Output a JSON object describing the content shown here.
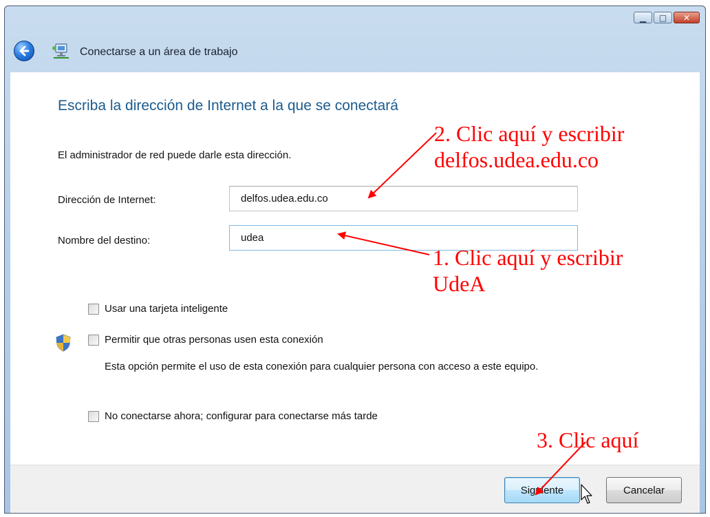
{
  "window": {
    "title": "Conectarse a un área de trabajo",
    "controls": {
      "minimize_icon": "minimize-icon",
      "maximize_icon": "maximize-icon",
      "close_icon": "close-icon"
    }
  },
  "icons": {
    "back": "back-arrow-icon",
    "wizard": "network-workplace-icon",
    "shield": "uac-shield-icon",
    "cursor": "mouse-pointer-icon"
  },
  "main": {
    "heading": "Escriba la dirección de Internet a la que se conectará",
    "help_text": "El administrador de red puede darle esta dirección.",
    "address_label": "Dirección de Internet:",
    "address_value": "delfos.udea.edu.co",
    "destination_label": "Nombre del destino:",
    "destination_value": "udea",
    "smartcard_label": "Usar una tarjeta inteligente",
    "allow_others_label": "Permitir que otras personas usen esta conexión",
    "allow_others_desc": "Esta opción permite el uso de esta conexión para cualquier persona con acceso a este equipo.",
    "connect_later_label": "No conectarse ahora; configurar para conectarse más tarde"
  },
  "footer": {
    "next_label": "Siguiente",
    "cancel_label": "Cancelar"
  },
  "annotations": {
    "step1_line1": "1.  Clic aquí y escribir",
    "step1_line2": "UdeA",
    "step2_line1": "2.  Clic aquí y escribir",
    "step2_line2": "delfos.udea.edu.co",
    "step3": "3. Clic aquí"
  },
  "colors": {
    "accent": "#1b5b8f",
    "annotation": "#ff0000",
    "frame": "#b7d0ea"
  }
}
